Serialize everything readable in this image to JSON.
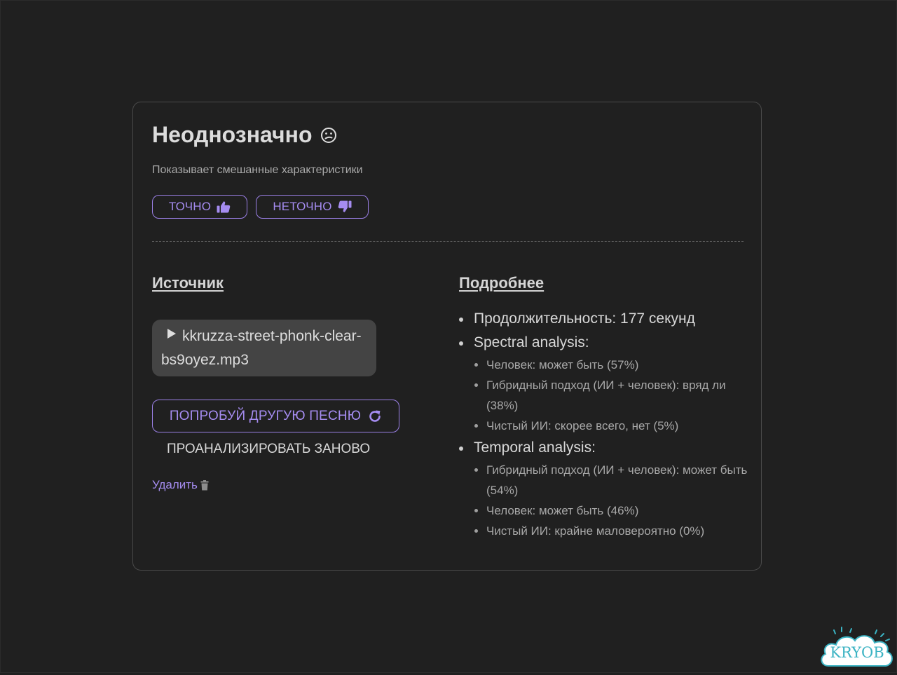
{
  "result": {
    "title": "Неоднозначно",
    "emoji": "confused-face-icon",
    "subtitle": "Показывает смешанные характеристики"
  },
  "feedback": {
    "accurate_label": "ТОЧНО",
    "inaccurate_label": "НЕТОЧНО"
  },
  "source": {
    "heading": "Источник",
    "file_name": "kkruzza-street-phonk-clear-bs9oyez.mp3",
    "try_another_label": "ПОПРОБУЙ ДРУГУЮ ПЕСНЮ",
    "reanalyze_label": "ПРОАНАЛИЗИРОВАТЬ ЗАНОВО",
    "delete_label": "Удалить"
  },
  "details": {
    "heading": "Подробнее",
    "duration": "Продолжительность: 177 секунд",
    "spectral": {
      "label": "Spectral analysis:",
      "items": [
        "Человек: может быть (57%)",
        "Гибридный подход (ИИ + человек): вряд ли (38%)",
        "Чистый ИИ: скорее всего, нет (5%)"
      ]
    },
    "temporal": {
      "label": "Temporal analysis:",
      "items": [
        "Гибридный подход (ИИ + человек): может быть (54%)",
        "Человек: может быть (46%)",
        "Чистый ИИ: крайне маловероятно (0%)"
      ]
    }
  },
  "watermark": {
    "text": "KRYOB"
  },
  "colors": {
    "background": "#202020",
    "accent": "#a58cf0",
    "card_border": "#4a4a4a",
    "file_box": "#444444",
    "watermark": "#3bb3c3"
  }
}
